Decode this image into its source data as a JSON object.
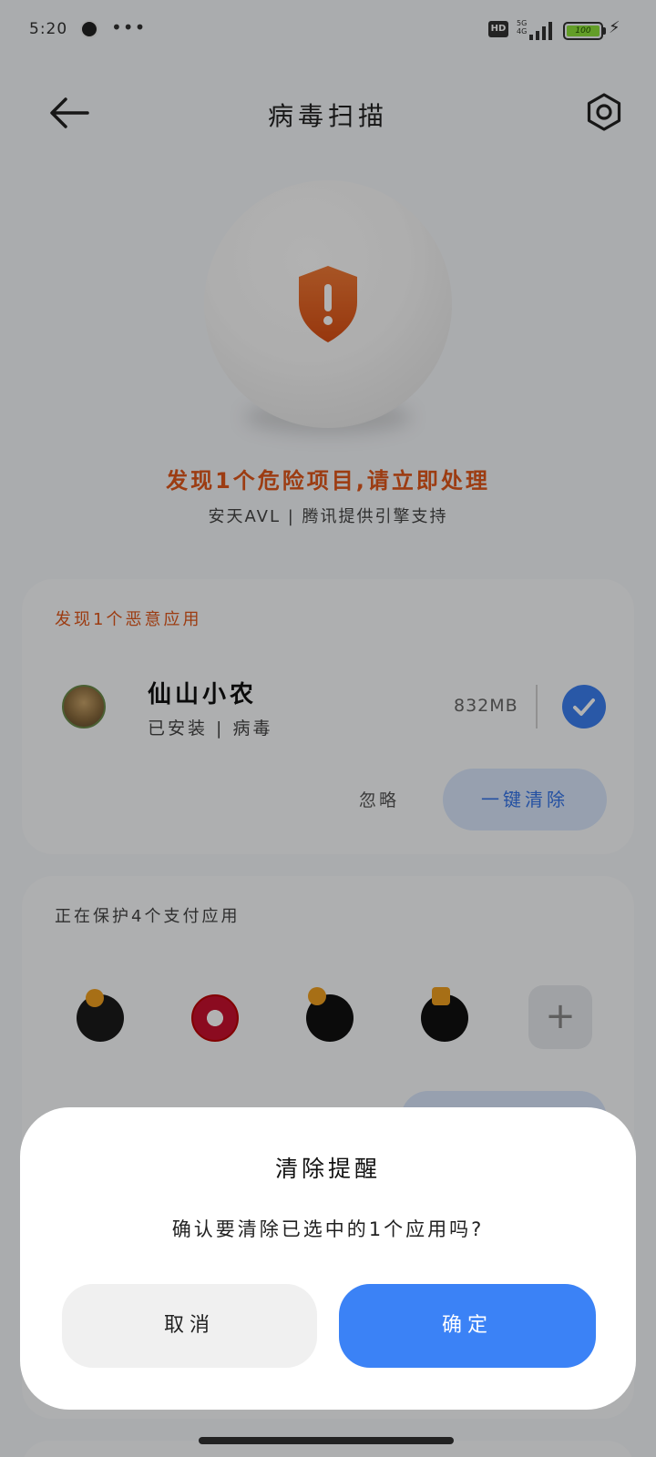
{
  "status_bar": {
    "time": "5:20",
    "more": "•••",
    "hd": "HD",
    "network_top": "5G",
    "network_bottom": "4G",
    "battery": "100"
  },
  "header": {
    "title": "病毒扫描"
  },
  "hero": {
    "alert": "发现1个危险项目,请立即处理",
    "engine": "安天AVL | 腾讯提供引擎支持",
    "alert_color": "#e0571b"
  },
  "malicious_card": {
    "title": "发现1个恶意应用",
    "app": {
      "name": "仙山小农",
      "status": "已安装 | 病毒",
      "size": "832MB",
      "selected": true
    },
    "ignore_label": "忽略",
    "clean_label": "一键清除"
  },
  "payment_card": {
    "title": "正在保护4个支付应用",
    "add_label": "+"
  },
  "dialog": {
    "title": "清除提醒",
    "message": "确认要清除已选中的1个应用吗?",
    "cancel_label": "取消",
    "confirm_label": "确定",
    "confirm_color": "#3b82f6"
  }
}
